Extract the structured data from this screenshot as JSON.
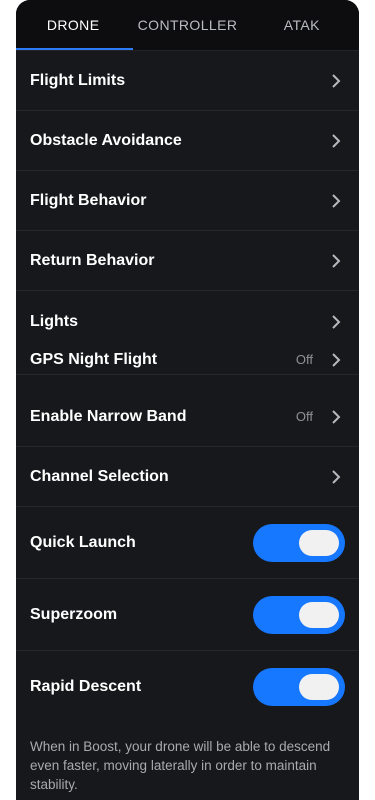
{
  "tabs": [
    {
      "label": "DRONE",
      "active": true
    },
    {
      "label": "CONTROLLER",
      "active": false
    },
    {
      "label": "ATAK",
      "active": false
    }
  ],
  "settings": [
    {
      "label": "Flight Limits",
      "value": "",
      "type": "nav"
    },
    {
      "label": "Obstacle Avoidance",
      "value": "",
      "type": "nav"
    },
    {
      "label": "Flight Behavior",
      "value": "",
      "type": "nav"
    },
    {
      "label": "Return Behavior",
      "value": "",
      "type": "nav"
    },
    {
      "label": "Lights",
      "value": "",
      "type": "nav"
    },
    {
      "label": "GPS Night Flight",
      "value": "Off",
      "type": "nav"
    },
    {
      "label": "Enable Narrow Band",
      "value": "Off",
      "type": "nav"
    },
    {
      "label": "Channel Selection",
      "value": "",
      "type": "nav"
    }
  ],
  "toggles": [
    {
      "label": "Quick Launch",
      "on": true
    },
    {
      "label": "Superzoom",
      "on": true
    },
    {
      "label": "Rapid Descent",
      "on": true
    }
  ],
  "footnote": "When in Boost, your drone will be able to descend even faster, moving laterally in order to maintain stability.",
  "colors": {
    "accent": "#2e7cf6",
    "toggle_on": "#1677ff",
    "background": "#17181b"
  },
  "icons": {
    "row_chevron": "chevron-right-icon"
  }
}
